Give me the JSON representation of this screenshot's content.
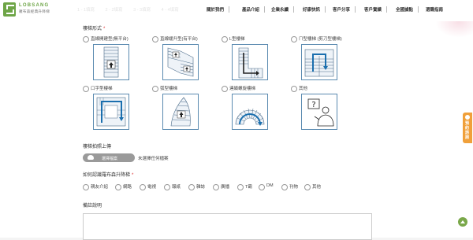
{
  "header": {
    "logo_en": "LOBSANG",
    "logo_zh": "羅布森經典升降梯",
    "breadcrumb": [
      "1 - 1填寫",
      "2 - 2填寫",
      "3 - 3填寫",
      "4 - 4填寫"
    ],
    "nav": [
      "關於我們",
      "產品介紹",
      "企業永續",
      "好康快訊",
      "客戶分享",
      "客戶實績",
      "全國據點",
      "選購指南"
    ]
  },
  "form": {
    "stair_section_label": "樓梯形式",
    "required_mark": "*",
    "stair_options": [
      {
        "label": "直線開建型(無平台)",
        "icon": "straight-stair-icon"
      },
      {
        "label": "直線緩升型(有平台)",
        "icon": "straight-landing-stair-icon"
      },
      {
        "label": "L型樓梯",
        "icon": "l-shaped-stair-icon"
      },
      {
        "label": "ㄇ型樓梯 (剪刀型樓梯)",
        "icon": "u-shaped-stair-icon"
      },
      {
        "label": "口字型樓梯",
        "icon": "square-stair-icon"
      },
      {
        "label": "弧型樓梯",
        "icon": "curved-stair-icon"
      },
      {
        "label": "連續螺旋樓梯",
        "icon": "spiral-stair-icon"
      },
      {
        "label": "其他",
        "icon": "question-person-icon"
      }
    ],
    "upload_section_label": "樓梯拍照上傳",
    "upload_button_label": "選擇檔案",
    "no_file_text": "未選擇任何檔案",
    "source_section_label": "如何認識羅布森升降梯",
    "source_options": [
      "親友介紹",
      "網路",
      "電視",
      "報紙",
      "雜誌",
      "廣播",
      "T霸",
      "DM",
      "刊物",
      "其他"
    ],
    "notes_section_label": "備註說明"
  },
  "side_tab": {
    "label": "預約諮詢"
  },
  "colors": {
    "brand_green": "#6ea547",
    "side_tab_orange": "#f0a03a",
    "required_red": "#d33333",
    "stair_border_blue": "#5a8ab0"
  }
}
